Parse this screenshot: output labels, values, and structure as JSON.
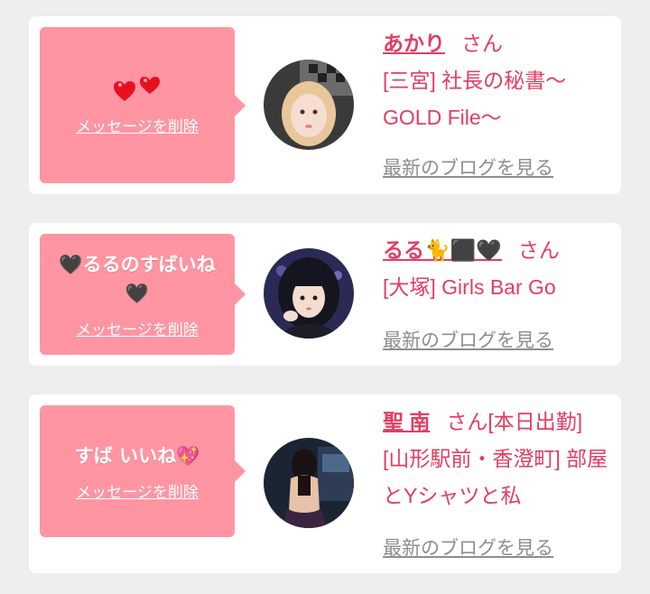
{
  "items": [
    {
      "message": "",
      "message_icon": "double-red-hearts-icon",
      "delete_label": "メッセージを削除",
      "name": "あかり",
      "honorific": "さん",
      "shop": "[三宮] 社長の秘書～GOLD File～",
      "blog_label": "最新のブログを見る",
      "avatar": "avatar-blonde-girl"
    },
    {
      "message": "🖤るるのすばいね🖤",
      "delete_label": "メッセージを削除",
      "name": "るる🐈⬛🖤",
      "honorific": "さん",
      "shop": "[大塚] Girls Bar Go",
      "blog_label": "最新のブログを見る",
      "avatar": "avatar-dark-hair-girl"
    },
    {
      "message": "すば いいね💖",
      "delete_label": "メッセージを削除",
      "name": "聖 南",
      "honorific": "さん[本日出勤]",
      "shop": "[山形駅前・香澄町] 部屋とYシャツと私",
      "blog_label": "最新のブログを見る",
      "avatar": "avatar-woman-back"
    }
  ],
  "colors": {
    "bubble": "#ff95a3",
    "accent_text": "#e23e63",
    "link_gray": "#8e8e8e",
    "background": "#eeeeee"
  }
}
